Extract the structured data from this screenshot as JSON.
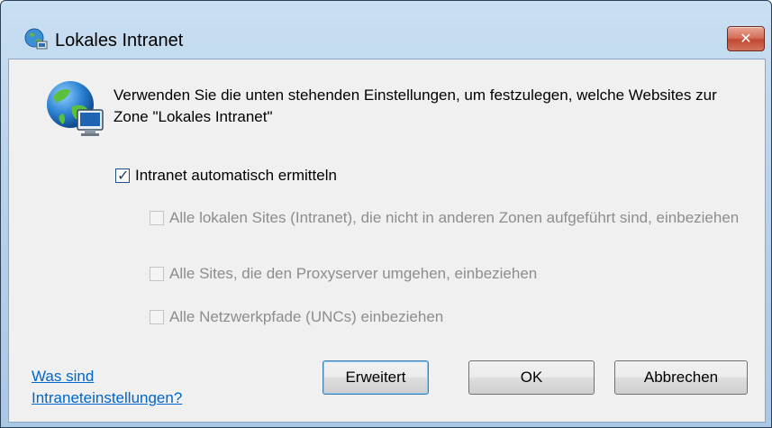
{
  "window": {
    "title": "Lokales Intranet",
    "close_label": "✕"
  },
  "description": "Verwenden Sie die unten stehenden Einstellungen, um festzulegen, welche Websites zur Zone \"Lokales Intranet\"",
  "options": {
    "auto_detect": {
      "label": "Intranet automatisch ermitteln",
      "checked": true,
      "enabled": true
    },
    "local_sites": {
      "label": "Alle lokalen Sites (Intranet), die nicht in anderen Zonen aufgeführt sind, einbeziehen",
      "checked": false,
      "enabled": false
    },
    "bypass_proxy": {
      "label": "Alle Sites, die den Proxyserver umgehen, einbeziehen",
      "checked": false,
      "enabled": false
    },
    "unc_paths": {
      "label": "Alle Netzwerkpfade (UNCs) einbeziehen",
      "checked": false,
      "enabled": false
    }
  },
  "help_link": "Was sind Intraneteinstellungen?",
  "buttons": {
    "advanced": "Erweitert",
    "ok": "OK",
    "cancel": "Abbrechen"
  },
  "colors": {
    "link": "#0066cc",
    "disabled_text": "#8d8d8d",
    "title_bar": "#b9d3ec",
    "close_button": "#c14a33"
  }
}
